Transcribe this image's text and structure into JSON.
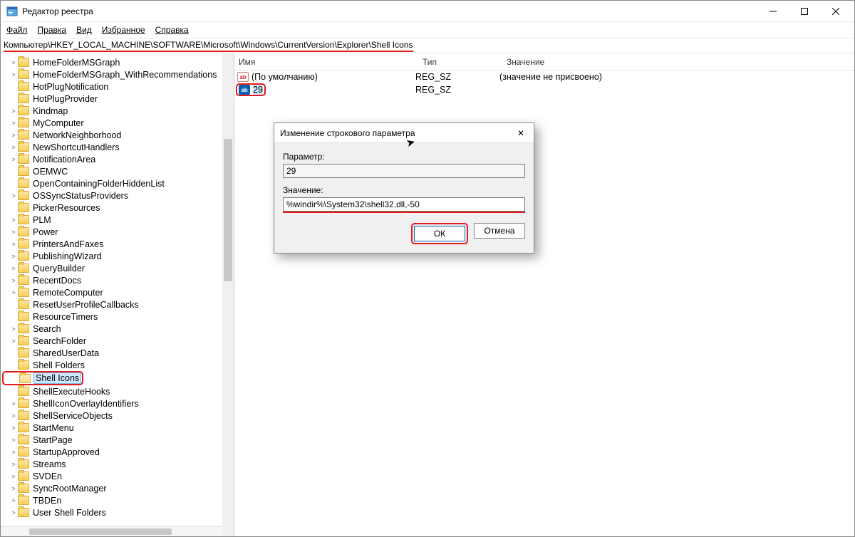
{
  "window": {
    "title": "Редактор реестра"
  },
  "menu": [
    "Файл",
    "Правка",
    "Вид",
    "Избранное",
    "Справка"
  ],
  "address": "Компьютер\\HKEY_LOCAL_MACHINE\\SOFTWARE\\Microsoft\\Windows\\CurrentVersion\\Explorer\\Shell Icons",
  "columns": {
    "name": "Имя",
    "type": "Тип",
    "value": "Значение"
  },
  "tree": [
    {
      "label": "HomeFolderMSGraph",
      "chev": ">"
    },
    {
      "label": "HomeFolderMSGraph_WithRecommendations",
      "chev": ">"
    },
    {
      "label": "HotPlugNotification",
      "chev": ""
    },
    {
      "label": "HotPlugProvider",
      "chev": ""
    },
    {
      "label": "Kindmap",
      "chev": ">"
    },
    {
      "label": "MyComputer",
      "chev": ">"
    },
    {
      "label": "NetworkNeighborhood",
      "chev": ">"
    },
    {
      "label": "NewShortcutHandlers",
      "chev": ">"
    },
    {
      "label": "NotificationArea",
      "chev": ">"
    },
    {
      "label": "OEMWC",
      "chev": ""
    },
    {
      "label": "OpenContainingFolderHiddenList",
      "chev": ""
    },
    {
      "label": "OSSyncStatusProviders",
      "chev": ">"
    },
    {
      "label": "PickerResources",
      "chev": ""
    },
    {
      "label": "PLM",
      "chev": ">"
    },
    {
      "label": "Power",
      "chev": ">"
    },
    {
      "label": "PrintersAndFaxes",
      "chev": ">"
    },
    {
      "label": "PublishingWizard",
      "chev": ">"
    },
    {
      "label": "QueryBuilder",
      "chev": ">"
    },
    {
      "label": "RecentDocs",
      "chev": ">"
    },
    {
      "label": "RemoteComputer",
      "chev": ">"
    },
    {
      "label": "ResetUserProfileCallbacks",
      "chev": ""
    },
    {
      "label": "ResourceTimers",
      "chev": ""
    },
    {
      "label": "Search",
      "chev": ">"
    },
    {
      "label": "SearchFolder",
      "chev": ">"
    },
    {
      "label": "SharedUserData",
      "chev": ""
    },
    {
      "label": "Shell Folders",
      "chev": ""
    },
    {
      "label": "Shell Icons",
      "chev": "",
      "selected": true,
      "redbox": true,
      "open": true
    },
    {
      "label": "ShellExecuteHooks",
      "chev": ""
    },
    {
      "label": "ShellIconOverlayIdentifiers",
      "chev": ">"
    },
    {
      "label": "ShellServiceObjects",
      "chev": ">"
    },
    {
      "label": "StartMenu",
      "chev": ">"
    },
    {
      "label": "StartPage",
      "chev": ">"
    },
    {
      "label": "StartupApproved",
      "chev": ">"
    },
    {
      "label": "Streams",
      "chev": ">"
    },
    {
      "label": "SVDEn",
      "chev": ">"
    },
    {
      "label": "SyncRootManager",
      "chev": ">"
    },
    {
      "label": "TBDEn",
      "chev": ">"
    },
    {
      "label": "User Shell Folders",
      "chev": ">"
    }
  ],
  "rows": [
    {
      "name": "(По умолчанию)",
      "type": "REG_SZ",
      "value": "(значение не присвоено)",
      "selected": false,
      "red": false,
      "ab": "ab"
    },
    {
      "name": "29",
      "type": "REG_SZ",
      "value": "",
      "selected": true,
      "red": true,
      "ab": "ab"
    }
  ],
  "dialog": {
    "title": "Изменение строкового параметра",
    "paramLabel": "Параметр:",
    "paramValue": "29",
    "valueLabel": "Значение:",
    "valueValue": "%windir%\\System32\\shell32.dll,-50",
    "ok": "ОК",
    "cancel": "Отмена"
  }
}
